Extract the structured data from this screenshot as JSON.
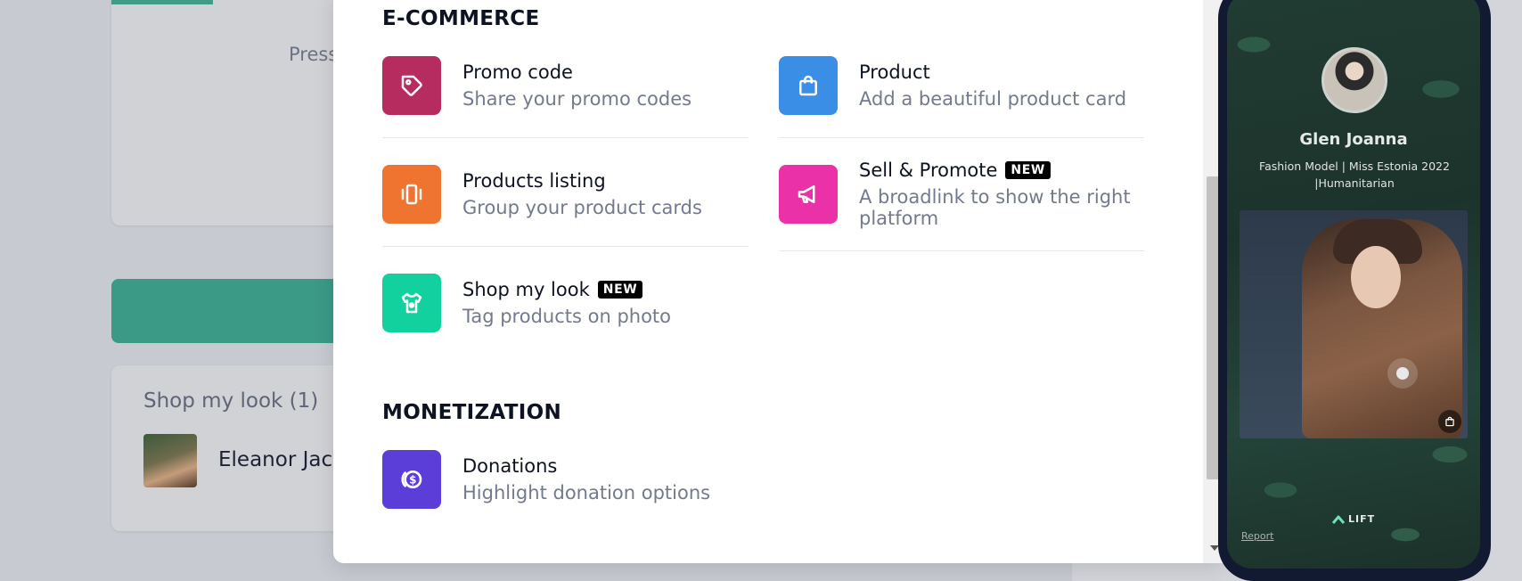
{
  "background": {
    "press_text": "Press",
    "shop_card_title": "Shop my look (1)",
    "shop_item_name": "Eleanor Jack"
  },
  "ecommerce": {
    "title": "E-COMMERCE",
    "items": [
      {
        "title": "Promo code",
        "desc": "Share your promo codes",
        "icon": "tag-icon",
        "color": "#b72c5e"
      },
      {
        "title": "Product",
        "desc": "Add a beautiful product card",
        "icon": "shopping-bag-icon",
        "color": "#3b8ee6"
      },
      {
        "title": "Products listing",
        "desc": "Group your product cards",
        "icon": "carousel-icon",
        "color": "#ee7430"
      },
      {
        "title": "Sell & Promote",
        "badge": "NEW",
        "desc": "A broadlink to show the right platform",
        "icon": "megaphone-icon",
        "color": "#ea31a8"
      },
      {
        "title": "Shop my look",
        "badge": "NEW",
        "desc": "Tag products on photo",
        "icon": "shirt-icon",
        "color": "#12d19e"
      }
    ]
  },
  "monetization": {
    "title": "MONETIZATION",
    "items": [
      {
        "title": "Donations",
        "desc": "Highlight donation options",
        "icon": "donation-icon",
        "color": "#5b3ed8"
      }
    ]
  },
  "preview": {
    "name": "Glen Joanna",
    "bio": "Fashion Model | Miss Estonia 2022 |Humanitarian",
    "brand": "LIFT",
    "report": "Report"
  }
}
